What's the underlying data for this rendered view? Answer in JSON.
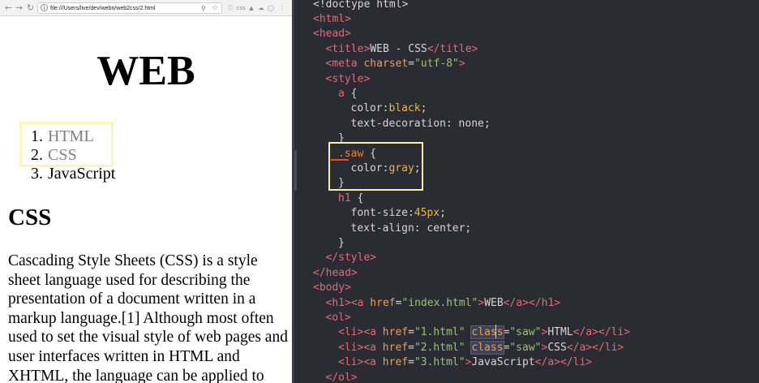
{
  "browser": {
    "address": "file:///Users/live/dev/webn/web2css/2.html",
    "page": {
      "title": "WEB",
      "list": [
        {
          "number": "1.",
          "text": "HTML"
        },
        {
          "number": "2.",
          "text": "CSS"
        },
        {
          "number": "3.",
          "text": "JavaScript"
        }
      ],
      "section_title": "CSS",
      "paragraph": "Cascading Style Sheets (CSS) is a style sheet language used for describing the presentation of a document written in a markup language.[1] Although most often used to set the visual style of web pages and user interfaces written in HTML and XHTML, the language can be applied to"
    }
  },
  "editor": {
    "lines": [
      {
        "indent": 0,
        "tokens": [
          {
            "t": "<!doctype html>",
            "k": "p"
          }
        ]
      },
      {
        "indent": 0,
        "tokens": [
          {
            "t": "<html>",
            "k": "t"
          }
        ]
      },
      {
        "indent": 0,
        "tokens": [
          {
            "t": "<head>",
            "k": "t"
          }
        ]
      },
      {
        "indent": 1,
        "tokens": [
          {
            "t": "<title>",
            "k": "t"
          },
          {
            "t": "WEB - CSS",
            "k": "p"
          },
          {
            "t": "</title>",
            "k": "t"
          }
        ]
      },
      {
        "indent": 1,
        "tokens": [
          {
            "t": "<meta",
            "k": "t"
          },
          {
            "t": " charset",
            "k": "a"
          },
          {
            "t": "=",
            "k": "p"
          },
          {
            "t": "\"utf-8\"",
            "k": "s"
          },
          {
            "t": ">",
            "k": "t"
          }
        ]
      },
      {
        "indent": 1,
        "tokens": [
          {
            "t": "<style>",
            "k": "t"
          }
        ]
      },
      {
        "indent": 2,
        "tokens": [
          {
            "t": "a",
            "k": "t"
          },
          {
            "t": " {",
            "k": "p"
          }
        ]
      },
      {
        "indent": 3,
        "tokens": [
          {
            "t": "color",
            "k": "p"
          },
          {
            "t": ":",
            "k": "p"
          },
          {
            "t": "black",
            "k": "v"
          },
          {
            "t": ";",
            "k": "p"
          }
        ]
      },
      {
        "indent": 3,
        "tokens": [
          {
            "t": "text-decoration",
            "k": "p"
          },
          {
            "t": ": none;",
            "k": "p"
          }
        ]
      },
      {
        "indent": 2,
        "tokens": [
          {
            "t": "}",
            "k": "p"
          }
        ]
      },
      {
        "indent": 2,
        "tokens": [
          {
            "t": ".saw",
            "k": "sel"
          },
          {
            "t": " {",
            "k": "p"
          }
        ]
      },
      {
        "indent": 3,
        "tokens": [
          {
            "t": "color",
            "k": "p"
          },
          {
            "t": ":",
            "k": "p"
          },
          {
            "t": "gray",
            "k": "v"
          },
          {
            "t": ";",
            "k": "p"
          }
        ]
      },
      {
        "indent": 2,
        "tokens": [
          {
            "t": "}",
            "k": "p"
          }
        ]
      },
      {
        "indent": 2,
        "tokens": [
          {
            "t": "h1",
            "k": "t"
          },
          {
            "t": " {",
            "k": "p"
          }
        ]
      },
      {
        "indent": 3,
        "tokens": [
          {
            "t": "font-size",
            "k": "p"
          },
          {
            "t": ":",
            "k": "p"
          },
          {
            "t": "45px",
            "k": "v"
          },
          {
            "t": ";",
            "k": "p"
          }
        ]
      },
      {
        "indent": 3,
        "tokens": [
          {
            "t": "text-align",
            "k": "p"
          },
          {
            "t": ": center;",
            "k": "p"
          }
        ]
      },
      {
        "indent": 2,
        "tokens": [
          {
            "t": "}",
            "k": "p"
          }
        ]
      },
      {
        "indent": 1,
        "tokens": [
          {
            "t": "</style>",
            "k": "t"
          }
        ]
      },
      {
        "indent": 0,
        "tokens": [
          {
            "t": "</head>",
            "k": "t"
          }
        ]
      },
      {
        "indent": 0,
        "tokens": [
          {
            "t": "<body>",
            "k": "t"
          }
        ]
      },
      {
        "indent": 1,
        "tokens": [
          {
            "t": "<h1>",
            "k": "t"
          },
          {
            "t": "<a",
            "k": "t"
          },
          {
            "t": " href",
            "k": "a"
          },
          {
            "t": "=",
            "k": "p"
          },
          {
            "t": "\"index.html\"",
            "k": "s"
          },
          {
            "t": ">",
            "k": "t"
          },
          {
            "t": "WEB",
            "k": "p"
          },
          {
            "t": "</a>",
            "k": "t"
          },
          {
            "t": "</h1>",
            "k": "t"
          }
        ]
      },
      {
        "indent": 1,
        "tokens": [
          {
            "t": "<ol>",
            "k": "t"
          }
        ]
      },
      {
        "indent": 2,
        "tokens": [
          {
            "t": "<li>",
            "k": "t"
          },
          {
            "t": "<a",
            "k": "t"
          },
          {
            "t": " href",
            "k": "a"
          },
          {
            "t": "=",
            "k": "p"
          },
          {
            "t": "\"1.html\"",
            "k": "s"
          },
          {
            "t": " ",
            "k": "p"
          },
          {
            "t": "class",
            "k": "a",
            "hl": true
          },
          {
            "t": "=",
            "k": "p"
          },
          {
            "t": "\"saw\"",
            "k": "s"
          },
          {
            "t": ">",
            "k": "t"
          },
          {
            "t": "HTML",
            "k": "p"
          },
          {
            "t": "</a>",
            "k": "t"
          },
          {
            "t": "</li>",
            "k": "t"
          }
        ]
      },
      {
        "indent": 2,
        "tokens": [
          {
            "t": "<li>",
            "k": "t"
          },
          {
            "t": "<a",
            "k": "t"
          },
          {
            "t": " href",
            "k": "a"
          },
          {
            "t": "=",
            "k": "p"
          },
          {
            "t": "\"2.html\"",
            "k": "s"
          },
          {
            "t": " ",
            "k": "p"
          },
          {
            "t": "class",
            "k": "a",
            "hl": true
          },
          {
            "t": "=",
            "k": "p"
          },
          {
            "t": "\"saw\"",
            "k": "s"
          },
          {
            "t": ">",
            "k": "t"
          },
          {
            "t": "CSS",
            "k": "p"
          },
          {
            "t": "</a>",
            "k": "t"
          },
          {
            "t": "</li>",
            "k": "t"
          }
        ]
      },
      {
        "indent": 2,
        "tokens": [
          {
            "t": "<li>",
            "k": "t"
          },
          {
            "t": "<a",
            "k": "t"
          },
          {
            "t": " href",
            "k": "a"
          },
          {
            "t": "=",
            "k": "p"
          },
          {
            "t": "\"3.html\"",
            "k": "s"
          },
          {
            "t": ">",
            "k": "t"
          },
          {
            "t": "JavaScript",
            "k": "p"
          },
          {
            "t": "</a>",
            "k": "t"
          },
          {
            "t": "</li>",
            "k": "t"
          }
        ]
      },
      {
        "indent": 1,
        "tokens": [
          {
            "t": "</ol>",
            "k": "t"
          }
        ]
      }
    ]
  },
  "colors": {
    "tag": "#e06c75",
    "attribute": "#e8a05c",
    "string": "#98c379",
    "editor_bg": "#2b2b33",
    "highlight_box": "#f6f0a8",
    "link_gray": "#808080"
  }
}
